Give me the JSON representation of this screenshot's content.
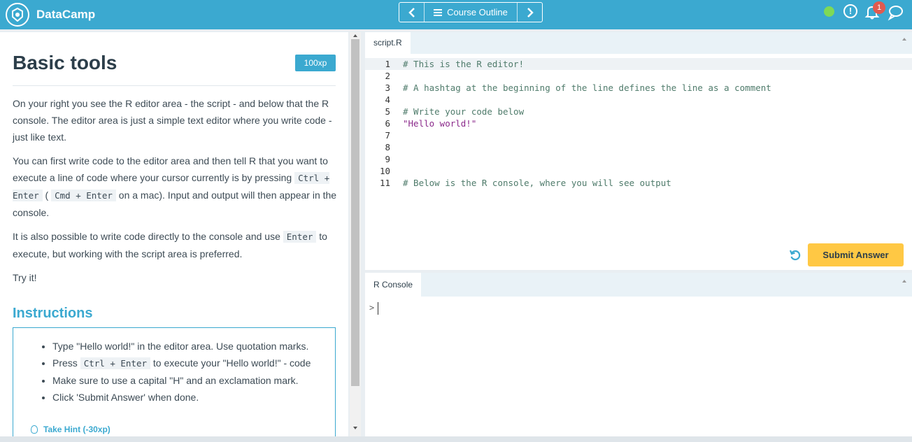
{
  "header": {
    "brand": "DataCamp",
    "nav": {
      "outline": "Course Outline"
    },
    "notifications": {
      "count": "1"
    },
    "info_label": "!",
    "colors": {
      "bar": "#3ba9d0",
      "status": "#7ed957",
      "badge": "#e05a4f"
    }
  },
  "exercise": {
    "title": "Basic tools",
    "xp": "100xp",
    "description": {
      "p1": "On your right you see the R editor area - the script - and below that the R console. The editor area is just a simple text editor where you write code - just like text.",
      "p2_a": "You can first write code to the editor area and then tell R that you want to execute a line of code where your cursor currently is by pressing",
      "p2_code1": "Ctrl + Enter",
      "p2_b": "(",
      "p2_code2": "Cmd + Enter",
      "p2_c": "on a mac). Input and output will then appear in the console.",
      "p3_a": "It is also possible to write code directly to the console and use",
      "p3_code": "Enter",
      "p3_b": "to execute, but working with the script area is preferred.",
      "p4": "Try it!"
    },
    "instructions_title": "Instructions",
    "instructions": {
      "i1": "Type \"Hello world!\" in the editor area. Use quotation marks.",
      "i2_a": "Press",
      "i2_code": "Ctrl + Enter",
      "i2_b": "to execute your \"Hello world!\" - code",
      "i3": "Make sure to use a capital \"H\" and an exclamation mark.",
      "i4": "Click 'Submit Answer' when done."
    },
    "hint": "Take Hint (-30xp)"
  },
  "editor": {
    "tab": "script.R",
    "lines": [
      {
        "n": "1",
        "text": "# This is the R editor!",
        "kind": "comment"
      },
      {
        "n": "2",
        "text": "",
        "kind": "plain"
      },
      {
        "n": "3",
        "text": "# A hashtag at the beginning of the line defines the line as a comment",
        "kind": "comment"
      },
      {
        "n": "4",
        "text": "",
        "kind": "plain"
      },
      {
        "n": "5",
        "text": "# Write your code below",
        "kind": "comment"
      },
      {
        "n": "6",
        "text": "\"Hello world!\"",
        "kind": "str"
      },
      {
        "n": "7",
        "text": "",
        "kind": "plain"
      },
      {
        "n": "8",
        "text": "",
        "kind": "plain"
      },
      {
        "n": "9",
        "text": "",
        "kind": "plain"
      },
      {
        "n": "10",
        "text": "",
        "kind": "plain"
      },
      {
        "n": "11",
        "text": "# Below is the R console, where you will see output",
        "kind": "comment"
      }
    ],
    "submit": "Submit Answer"
  },
  "console": {
    "tab": "R Console",
    "prompt": ">"
  }
}
